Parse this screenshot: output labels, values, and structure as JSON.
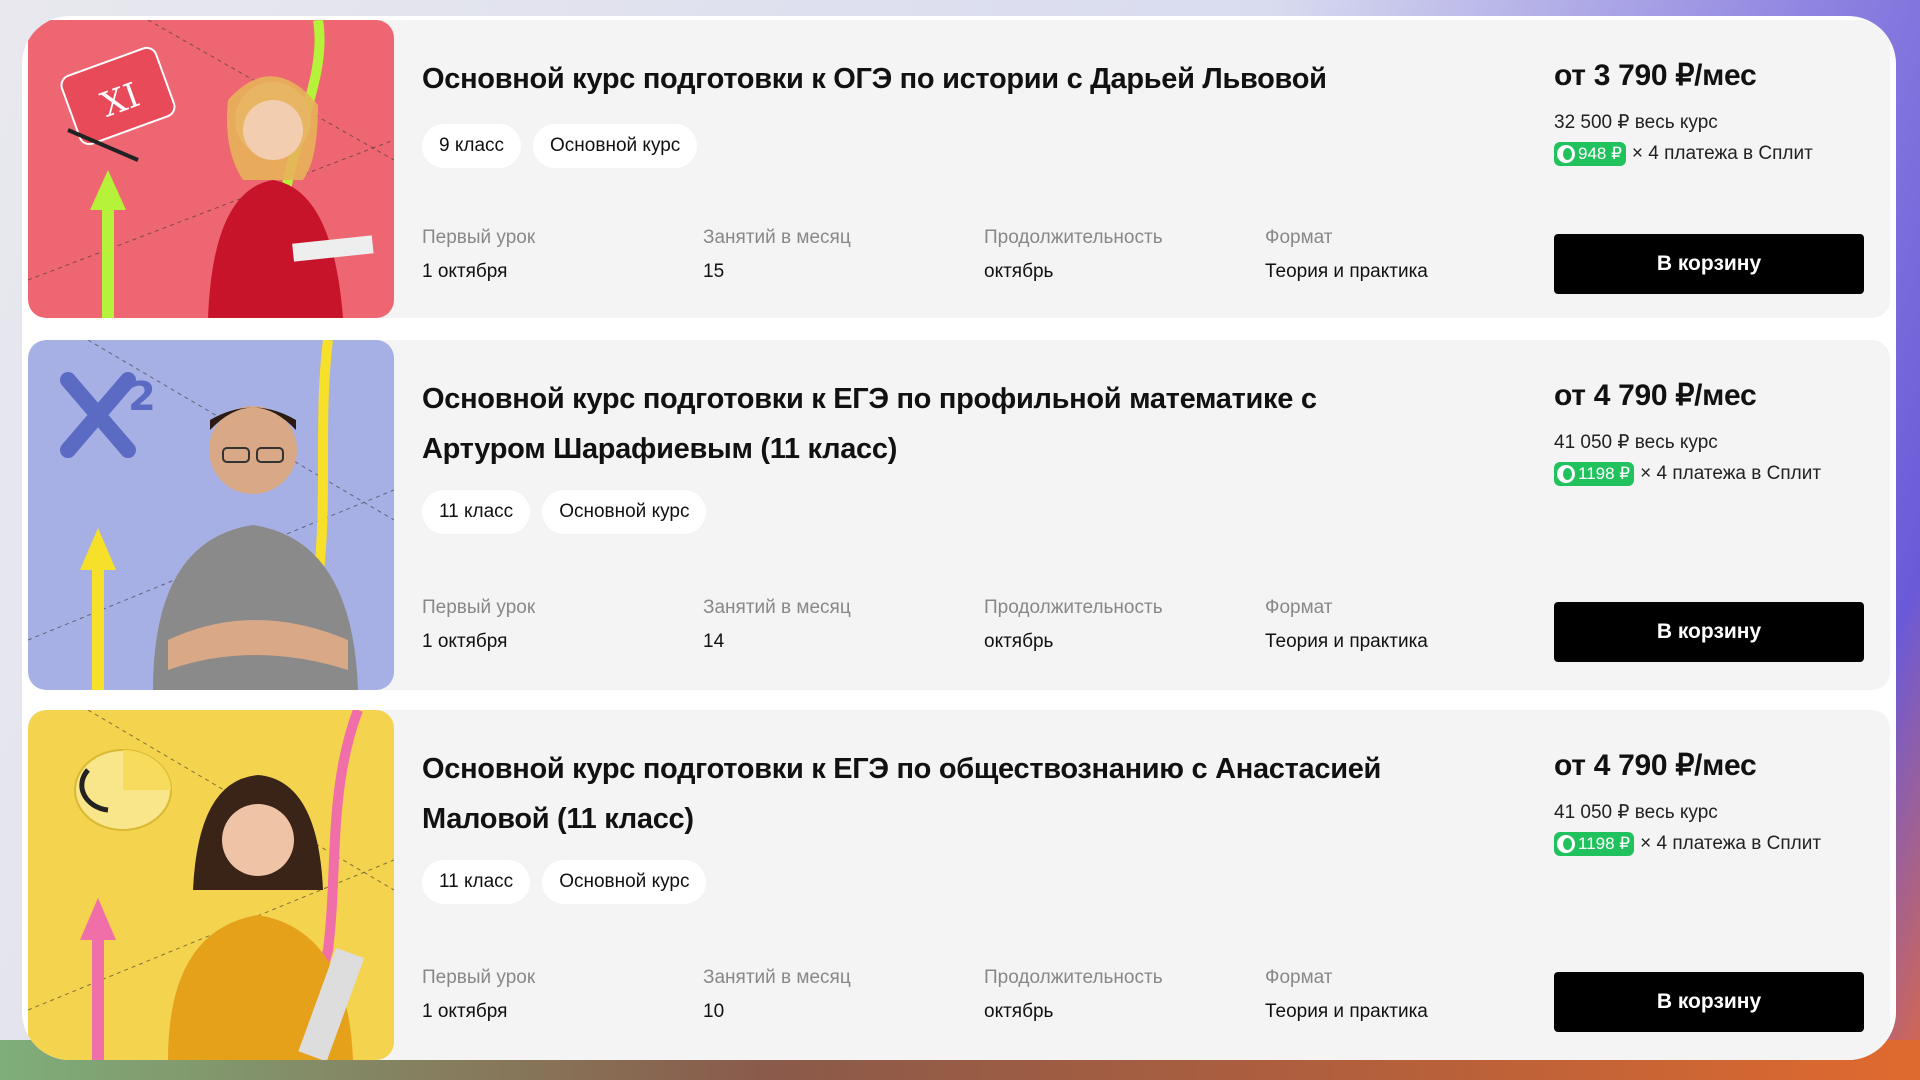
{
  "colors": {
    "split_green": "#21c25e",
    "button_bg": "#000000",
    "thumb_history": "#ef6673",
    "thumb_math": "#a7b0e4",
    "thumb_social": "#f4d34e"
  },
  "labels": {
    "first_lesson": "Первый урок",
    "lessons_per_month": "Занятий в месяц",
    "duration": "Продолжительность",
    "format": "Формат",
    "cart_button": "В корзину",
    "split_suffix": "× 4 платежа в Сплит"
  },
  "courses": [
    {
      "title": "Основной курс подготовки к ОГЭ по истории с Дарьей Львовой",
      "tags": [
        "9 класс",
        "Основной курс"
      ],
      "first_lesson": "1 октября",
      "lessons_per_month": "15",
      "duration": "октябрь",
      "format": "Теория и практика",
      "price_month": "от 3 790 ₽/мес",
      "price_full": "32 500 ₽ весь курс",
      "split_amount": "948 ₽",
      "thumb_icon": "scroll-icon"
    },
    {
      "title": "Основной курс подготовки к ЕГЭ по профильной математике с Артуром Шарафиевым (11 класс)",
      "tags": [
        "11 класс",
        "Основной курс"
      ],
      "first_lesson": "1 октября",
      "lessons_per_month": "14",
      "duration": "октябрь",
      "format": "Теория и практика",
      "price_month": "от 4 790 ₽/мес",
      "price_full": "41 050 ₽ весь курс",
      "split_amount": "1198 ₽",
      "thumb_icon": "x-squared-icon"
    },
    {
      "title": "Основной курс подготовки к ЕГЭ по обществознанию с Анастасией Маловой (11 класс)",
      "tags": [
        "11 класс",
        "Основной курс"
      ],
      "first_lesson": "1 октября",
      "lessons_per_month": "10",
      "duration": "октябрь",
      "format": "Теория и практика",
      "price_month": "от 4 790 ₽/мес",
      "price_full": "41 050 ₽ весь курс",
      "split_amount": "1198 ₽",
      "thumb_icon": "pie-chart-icon"
    }
  ]
}
